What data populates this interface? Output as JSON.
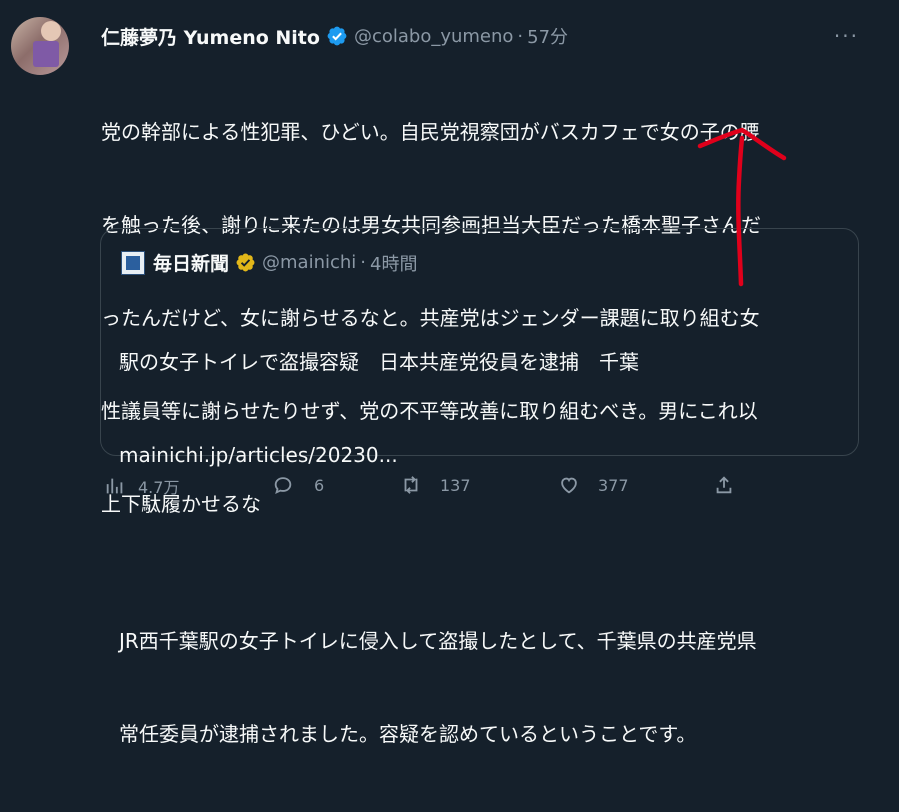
{
  "tweet": {
    "author_name": "仁藤夢乃 Yumeno Nito",
    "handle": "@colabo_yumeno",
    "separator": "·",
    "time": "57分",
    "more_label": "···",
    "text_lines": [
      "党の幹部による性犯罪、ひどい。自民党視察団がバスカフェで女の子の腰",
      "を触った後、謝りに来たのは男女共同参画担当大臣だった橋本聖子さんだ",
      "ったんだけど、女に謝らせるなと。共産党はジェンダー課題に取り組む女",
      "性議員等に謝らせたりせず、党の不平等改善に取り組むべき。男にこれ以",
      "上下駄履かせるな"
    ]
  },
  "quote": {
    "author_name": "毎日新聞",
    "handle": "@mainichi",
    "separator": "·",
    "time": "4時間",
    "title_line": "駅の女子トイレで盗撮容疑　日本共産党役員を逮捕　千葉",
    "link": "mainichi.jp/articles/20230...",
    "body_lines": [
      "JR西千葉駅の女子トイレに侵入して盗撮したとして、千葉県の共産党県",
      "常任委員が逮捕されました。容疑を認めているということです。"
    ]
  },
  "actions": {
    "views": "4.7万",
    "replies": "6",
    "retweets": "137",
    "likes": "377"
  },
  "colors": {
    "background": "#15202b",
    "verified_blue": "#1d9bf0",
    "verified_gold": "#e2b719",
    "annotation_red": "#e0001b"
  },
  "icons": {
    "views": "views-icon",
    "reply": "reply-icon",
    "retweet": "retweet-icon",
    "like": "heart-icon",
    "share": "share-icon"
  }
}
